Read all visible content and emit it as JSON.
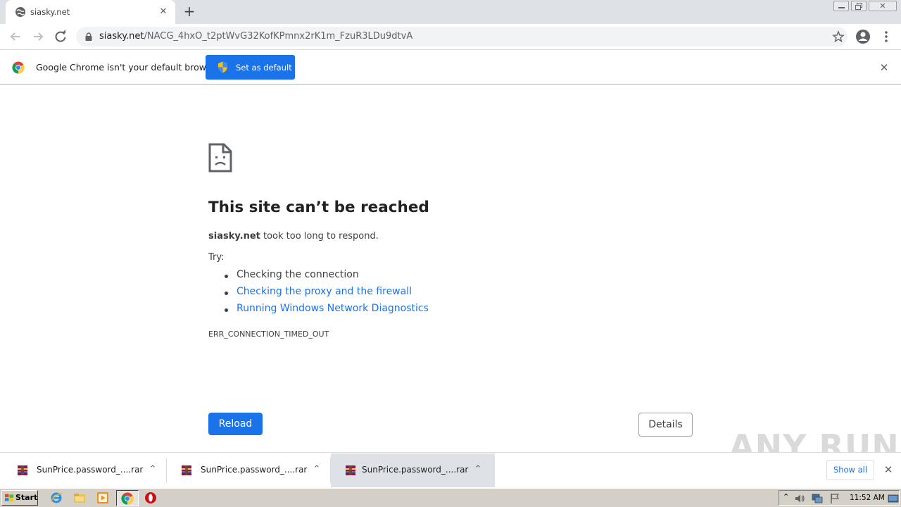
{
  "browser": {
    "tab": {
      "title": "siasky.net"
    },
    "omnibox": {
      "host": "siasky.net",
      "path": "/NACG_4hxO_t2ptWvG32KofKPmnx2rK1m_FzuR3LDu9dtvA"
    },
    "infobar": {
      "message": "Google Chrome isn't your default browser",
      "button_label": "Set as default"
    }
  },
  "error_page": {
    "title": "This site can’t be reached",
    "host": "siasky.net",
    "description_suffix": " took too long to respond.",
    "try_label": "Try:",
    "suggestions": [
      {
        "text": "Checking the connection",
        "is_link": false
      },
      {
        "text": "Checking the proxy and the firewall",
        "is_link": true
      },
      {
        "text": "Running Windows Network Diagnostics",
        "is_link": true
      }
    ],
    "error_code": "ERR_CONNECTION_TIMED_OUT",
    "reload_label": "Reload",
    "details_label": "Details"
  },
  "watermark": "ANY RUN",
  "downloads": {
    "items": [
      {
        "name": "SunPrice.password_....rar"
      },
      {
        "name": "SunPrice.password_....rar"
      },
      {
        "name": "SunPrice.password_....rar"
      }
    ],
    "show_all_label": "Show all"
  },
  "taskbar": {
    "start_label": "Start",
    "clock": "11:52 AM"
  },
  "colors": {
    "accent": "#1a73e8",
    "tabstrip": "#dee1e6",
    "taskbar": "#d4d0c8"
  }
}
